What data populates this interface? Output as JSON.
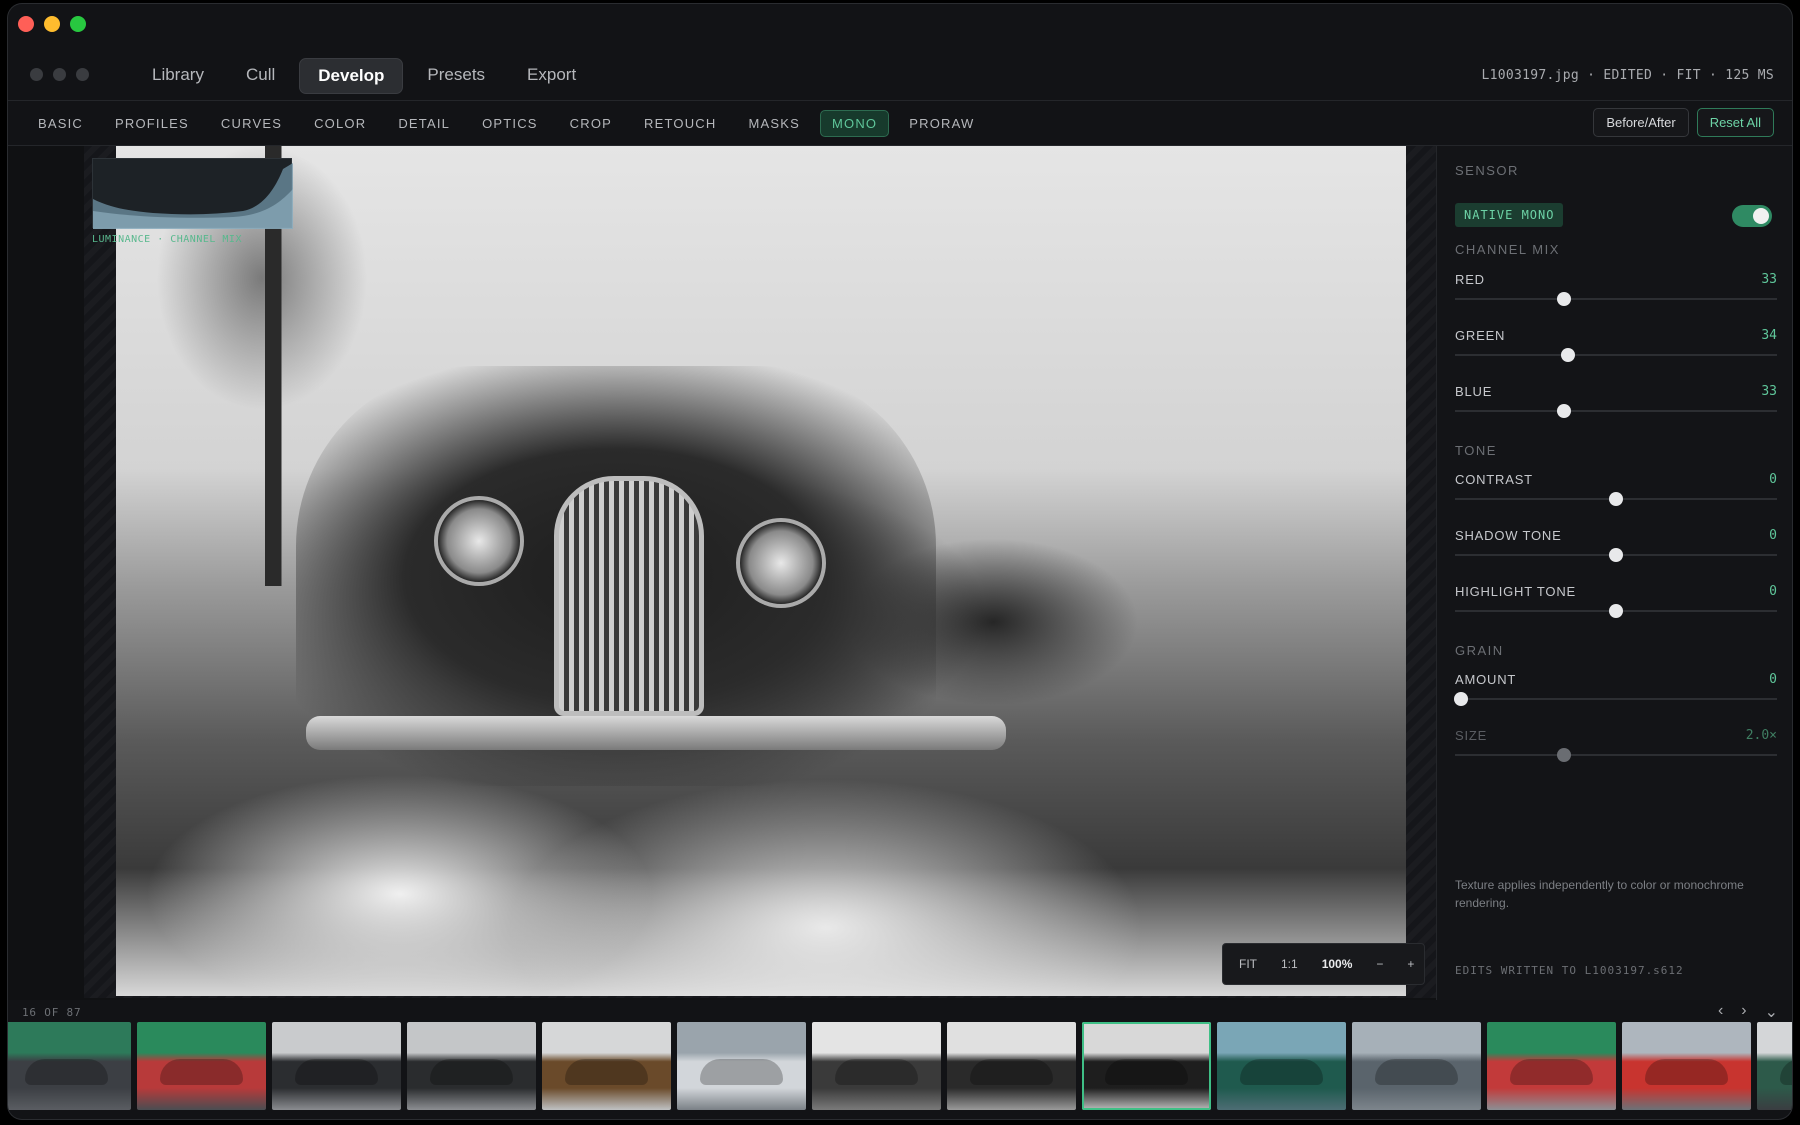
{
  "app": {
    "nav_tabs": [
      {
        "label": "Library",
        "active": false
      },
      {
        "label": "Cull",
        "active": false
      },
      {
        "label": "Develop",
        "active": true
      },
      {
        "label": "Presets",
        "active": false
      },
      {
        "label": "Export",
        "active": false
      }
    ],
    "file_info": "L1003197.jpg · EDITED · FIT · 125 MS"
  },
  "modules": {
    "tabs": [
      {
        "label": "BASIC",
        "active": false
      },
      {
        "label": "PROFILES",
        "active": false
      },
      {
        "label": "CURVES",
        "active": false
      },
      {
        "label": "COLOR",
        "active": false
      },
      {
        "label": "DETAIL",
        "active": false
      },
      {
        "label": "OPTICS",
        "active": false
      },
      {
        "label": "CROP",
        "active": false
      },
      {
        "label": "RETOUCH",
        "active": false
      },
      {
        "label": "MASKS",
        "active": false
      },
      {
        "label": "MONO",
        "active": true
      },
      {
        "label": "PRORAW",
        "active": false
      }
    ],
    "before_after_label": "Before/After",
    "reset_all_label": "Reset All"
  },
  "canvas": {
    "histogram_label": "LUMINANCE · CHANNEL MIX",
    "zoom": {
      "fit": "FIT",
      "one_to_one": "1:1",
      "level": "100%",
      "minus": "−",
      "plus": "+"
    }
  },
  "panel": {
    "sensor_title": "SENSOR",
    "native_mono_label": "NATIVE MONO",
    "native_mono_enabled": true,
    "channel_mix_title": "CHANNEL MIX",
    "channel_mix": [
      {
        "label": "RED",
        "value": "33",
        "fraction": 0.34
      },
      {
        "label": "GREEN",
        "value": "34",
        "fraction": 0.35
      },
      {
        "label": "BLUE",
        "value": "33",
        "fraction": 0.34
      }
    ],
    "tone_title": "TONE",
    "tone": [
      {
        "label": "CONTRAST",
        "value": "0",
        "fraction": 0.5
      },
      {
        "label": "SHADOW TONE",
        "value": "0",
        "fraction": 0.5
      },
      {
        "label": "HIGHLIGHT TONE",
        "value": "0",
        "fraction": 0.5
      }
    ],
    "grain_title": "GRAIN",
    "grain": [
      {
        "label": "AMOUNT",
        "value": "0",
        "fraction": 0.02,
        "disabled": false
      },
      {
        "label": "SIZE",
        "value": "2.0×",
        "fraction": 0.34,
        "disabled": true
      }
    ],
    "note": "Texture applies independently to color or monochrome rendering.",
    "footer": "EDITS WRITTEN TO L1003197.s612"
  },
  "filmstrip": {
    "counter": "16 OF 87",
    "prev_icon": "‹",
    "next_icon": "›",
    "collapse_icon": "⌄",
    "selected_index": 8,
    "thumbnails": [
      {
        "top": "#2d7a5a",
        "mid": "#3c3f44",
        "bottom": "#5a5d62"
      },
      {
        "top": "#2a8a5c",
        "mid": "#b83a3a",
        "bottom": "#4a4d52"
      },
      {
        "top": "#c9cbcd",
        "mid": "#2b2d30",
        "bottom": "#8a8c90"
      },
      {
        "top": "#c4c6c8",
        "mid": "#2a2c2e",
        "bottom": "#8c8e92"
      },
      {
        "top": "#d6d7d8",
        "mid": "#6a4a2a",
        "bottom": "#bfc1c3"
      },
      {
        "top": "#9aa4ac",
        "mid": "#d2d6da",
        "bottom": "#7a8086"
      },
      {
        "top": "#e4e4e4",
        "mid": "#3a3a3a",
        "bottom": "#7a7a7a"
      },
      {
        "top": "#e0e0e0",
        "mid": "#2a2a2a",
        "bottom": "#9a9a9a"
      },
      {
        "top": "#d8d8d8",
        "mid": "#1e1e1e",
        "bottom": "#bdbdbd"
      },
      {
        "top": "#7aa6b6",
        "mid": "#1f5a4e",
        "bottom": "#4d6d74"
      },
      {
        "top": "#a6b0b8",
        "mid": "#5a646c",
        "bottom": "#7d858c"
      },
      {
        "top": "#2a8a5c",
        "mid": "#c23a3a",
        "bottom": "#8b8f94"
      },
      {
        "top": "#aeb6be",
        "mid": "#c8342f",
        "bottom": "#6b7278"
      },
      {
        "top": "#d4d6d8",
        "mid": "#2d5a4a",
        "bottom": "#3a3d41"
      }
    ]
  }
}
